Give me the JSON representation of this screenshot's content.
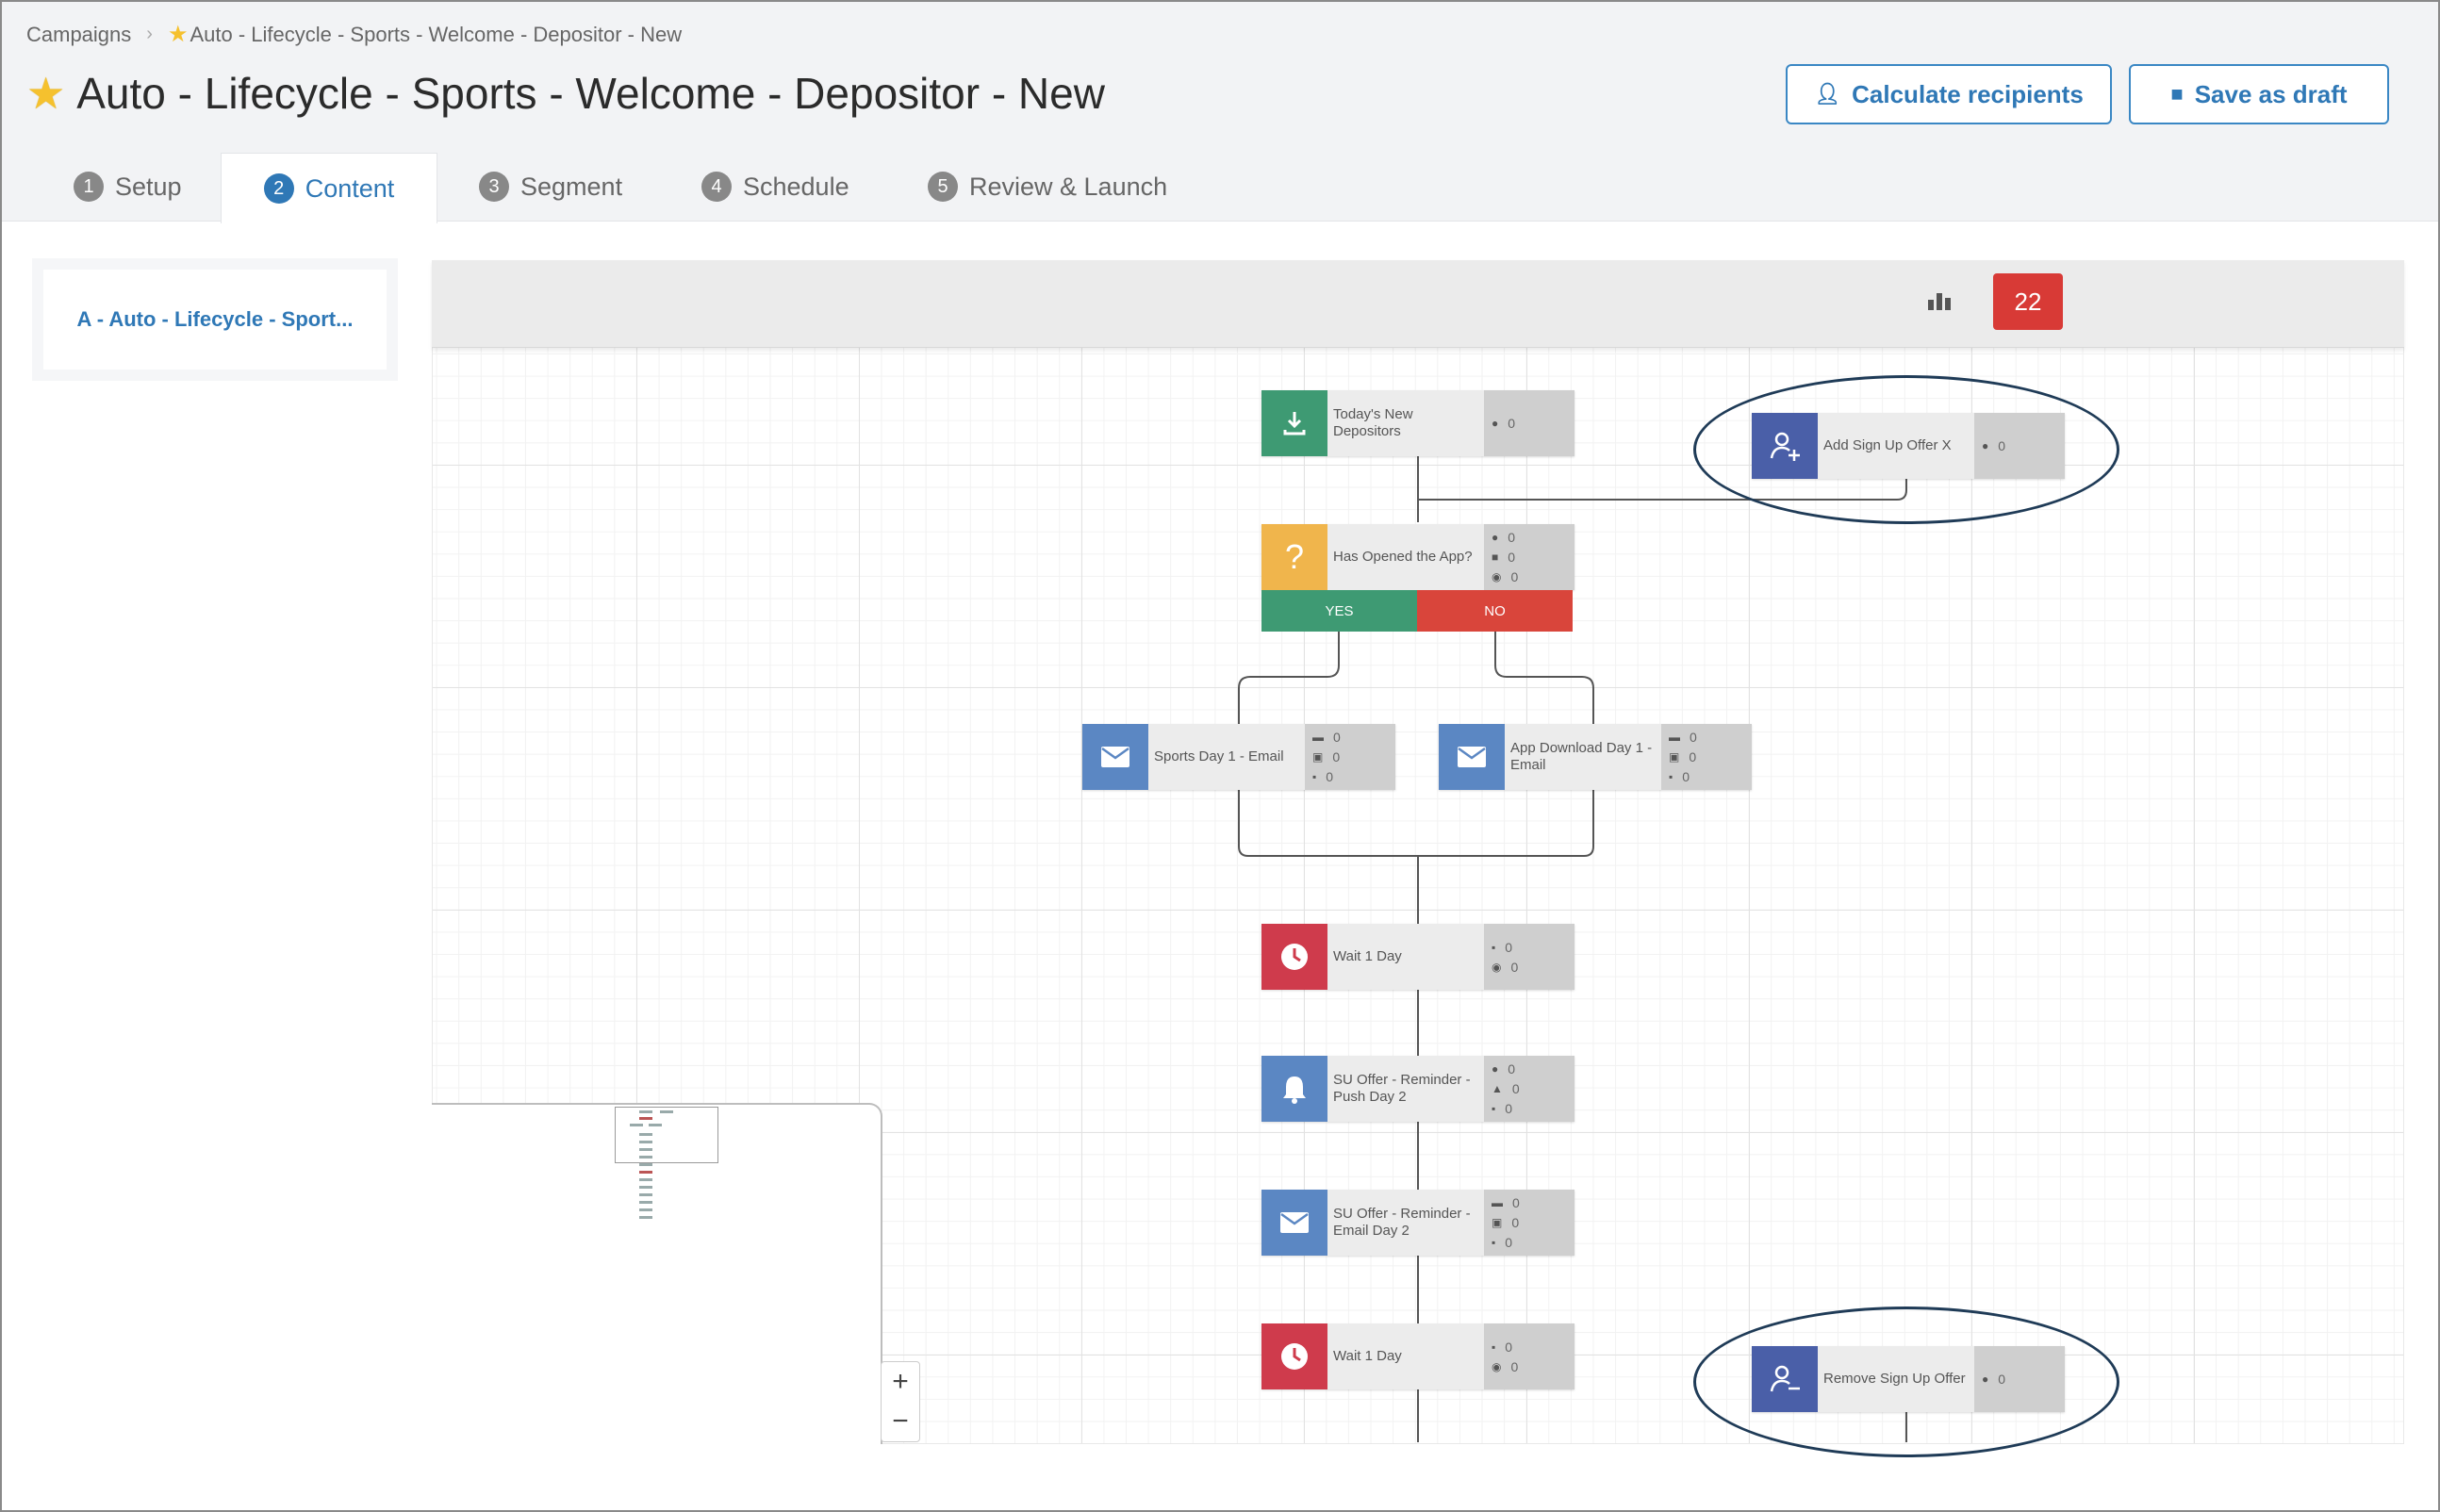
{
  "breadcrumb": {
    "root": "Campaigns",
    "current": "Auto - Lifecycle - Sports - Welcome - Depositor - New"
  },
  "page_title": "Auto - Lifecycle - Sports - Welcome - Depositor - New",
  "actions": {
    "calculate": "Calculate recipients",
    "save": "Save as draft"
  },
  "tabs": [
    {
      "num": "1",
      "label": "Setup"
    },
    {
      "num": "2",
      "label": "Content"
    },
    {
      "num": "3",
      "label": "Segment"
    },
    {
      "num": "4",
      "label": "Schedule"
    },
    {
      "num": "5",
      "label": "Review & Launch"
    }
  ],
  "variant_label": "A - Auto - Lifecycle - Sport...",
  "toolbar": {
    "badge_count": "22"
  },
  "colors": {
    "accent": "#2f78b6",
    "badge": "#d83a36",
    "yes": "#3e9a73",
    "no": "#d9453b"
  },
  "nodes": {
    "new_depositors": {
      "label": "Today's New Depositors",
      "stats": [
        "0"
      ]
    },
    "add_offer": {
      "label": "Add Sign Up Offer X",
      "stats": [
        "0"
      ]
    },
    "opened_app": {
      "label": "Has Opened the App?",
      "stats": [
        "0",
        "0",
        "0"
      ],
      "yes": "YES",
      "no": "NO"
    },
    "sports_email": {
      "label": "Sports Day 1 - Email",
      "stats": [
        "0",
        "0",
        "0"
      ]
    },
    "app_download": {
      "label": "App Download Day 1 - Email",
      "stats": [
        "0",
        "0",
        "0"
      ]
    },
    "wait1": {
      "label": "Wait 1 Day",
      "stats": [
        "0",
        "0"
      ]
    },
    "push_reminder": {
      "label": "SU Offer - Reminder - Push Day 2",
      "stats": [
        "0",
        "0",
        "0"
      ]
    },
    "email_reminder": {
      "label": "SU Offer - Reminder - Email Day 2",
      "stats": [
        "0",
        "0",
        "0"
      ]
    },
    "wait2": {
      "label": "Wait 1 Day",
      "stats": [
        "0",
        "0"
      ]
    },
    "remove_offer": {
      "label": "Remove Sign Up Offer",
      "stats": [
        "0"
      ]
    }
  },
  "zoom": {
    "in": "+",
    "out": "−"
  }
}
